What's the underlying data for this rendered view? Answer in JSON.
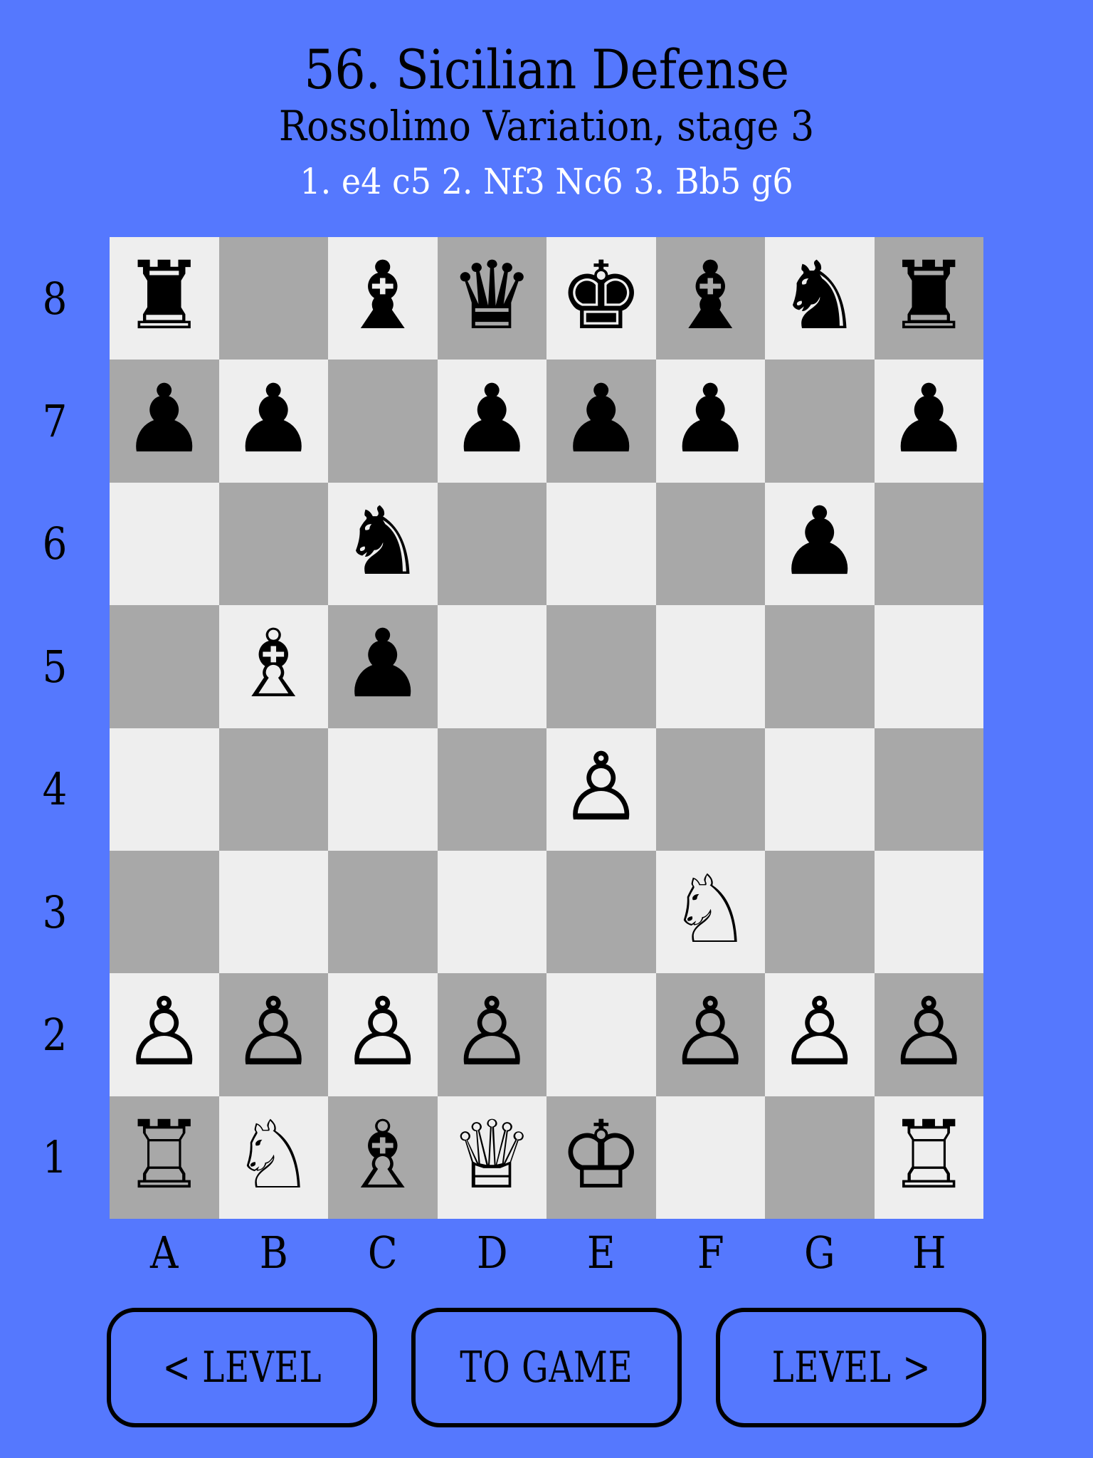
{
  "app": {
    "background_color": "#5578fe",
    "text_color": "#000000",
    "move_text_color": "#ffffff"
  },
  "header": {
    "title": "56. Sicilian Defense",
    "subtitle": "Rossolimo Variation, stage 3",
    "moves": "1. e4 c5 2. Nf3 Nc6 3. Bb5 g6"
  },
  "board": {
    "light_square_color": "#eeeeee",
    "dark_square_color": "#a8a8a8",
    "orientation": "white",
    "rank_labels": [
      "8",
      "7",
      "6",
      "5",
      "4",
      "3",
      "2",
      "1"
    ],
    "file_labels": [
      "A",
      "B",
      "C",
      "D",
      "E",
      "F",
      "G",
      "H"
    ],
    "fen": "r1bqkbnr/pp1ppp1p/2n3p1/1Bp5/4P3/5N2/PPPP1PPP/RNBQK2R",
    "squares": [
      [
        {
          "square": "a8",
          "shade": "light",
          "piece": "black-rook",
          "glyph": "♜"
        },
        {
          "square": "b8",
          "shade": "dark",
          "piece": null,
          "glyph": ""
        },
        {
          "square": "c8",
          "shade": "light",
          "piece": "black-bishop",
          "glyph": "♝"
        },
        {
          "square": "d8",
          "shade": "dark",
          "piece": "black-queen",
          "glyph": "♛"
        },
        {
          "square": "e8",
          "shade": "light",
          "piece": "black-king",
          "glyph": "♚"
        },
        {
          "square": "f8",
          "shade": "dark",
          "piece": "black-bishop",
          "glyph": "♝"
        },
        {
          "square": "g8",
          "shade": "light",
          "piece": "black-knight",
          "glyph": "♞"
        },
        {
          "square": "h8",
          "shade": "dark",
          "piece": "black-rook",
          "glyph": "♜"
        }
      ],
      [
        {
          "square": "a7",
          "shade": "dark",
          "piece": "black-pawn",
          "glyph": "♟"
        },
        {
          "square": "b7",
          "shade": "light",
          "piece": "black-pawn",
          "glyph": "♟"
        },
        {
          "square": "c7",
          "shade": "dark",
          "piece": null,
          "glyph": ""
        },
        {
          "square": "d7",
          "shade": "light",
          "piece": "black-pawn",
          "glyph": "♟"
        },
        {
          "square": "e7",
          "shade": "dark",
          "piece": "black-pawn",
          "glyph": "♟"
        },
        {
          "square": "f7",
          "shade": "light",
          "piece": "black-pawn",
          "glyph": "♟"
        },
        {
          "square": "g7",
          "shade": "dark",
          "piece": null,
          "glyph": ""
        },
        {
          "square": "h7",
          "shade": "light",
          "piece": "black-pawn",
          "glyph": "♟"
        }
      ],
      [
        {
          "square": "a6",
          "shade": "light",
          "piece": null,
          "glyph": ""
        },
        {
          "square": "b6",
          "shade": "dark",
          "piece": null,
          "glyph": ""
        },
        {
          "square": "c6",
          "shade": "light",
          "piece": "black-knight",
          "glyph": "♞"
        },
        {
          "square": "d6",
          "shade": "dark",
          "piece": null,
          "glyph": ""
        },
        {
          "square": "e6",
          "shade": "light",
          "piece": null,
          "glyph": ""
        },
        {
          "square": "f6",
          "shade": "dark",
          "piece": null,
          "glyph": ""
        },
        {
          "square": "g6",
          "shade": "light",
          "piece": "black-pawn",
          "glyph": "♟"
        },
        {
          "square": "h6",
          "shade": "dark",
          "piece": null,
          "glyph": ""
        }
      ],
      [
        {
          "square": "a5",
          "shade": "dark",
          "piece": null,
          "glyph": ""
        },
        {
          "square": "b5",
          "shade": "light",
          "piece": "white-bishop",
          "glyph": "♗"
        },
        {
          "square": "c5",
          "shade": "dark",
          "piece": "black-pawn",
          "glyph": "♟"
        },
        {
          "square": "d5",
          "shade": "light",
          "piece": null,
          "glyph": ""
        },
        {
          "square": "e5",
          "shade": "dark",
          "piece": null,
          "glyph": ""
        },
        {
          "square": "f5",
          "shade": "light",
          "piece": null,
          "glyph": ""
        },
        {
          "square": "g5",
          "shade": "dark",
          "piece": null,
          "glyph": ""
        },
        {
          "square": "h5",
          "shade": "light",
          "piece": null,
          "glyph": ""
        }
      ],
      [
        {
          "square": "a4",
          "shade": "light",
          "piece": null,
          "glyph": ""
        },
        {
          "square": "b4",
          "shade": "dark",
          "piece": null,
          "glyph": ""
        },
        {
          "square": "c4",
          "shade": "light",
          "piece": null,
          "glyph": ""
        },
        {
          "square": "d4",
          "shade": "dark",
          "piece": null,
          "glyph": ""
        },
        {
          "square": "e4",
          "shade": "light",
          "piece": "white-pawn",
          "glyph": "♙"
        },
        {
          "square": "f4",
          "shade": "dark",
          "piece": null,
          "glyph": ""
        },
        {
          "square": "g4",
          "shade": "light",
          "piece": null,
          "glyph": ""
        },
        {
          "square": "h4",
          "shade": "dark",
          "piece": null,
          "glyph": ""
        }
      ],
      [
        {
          "square": "a3",
          "shade": "dark",
          "piece": null,
          "glyph": ""
        },
        {
          "square": "b3",
          "shade": "light",
          "piece": null,
          "glyph": ""
        },
        {
          "square": "c3",
          "shade": "dark",
          "piece": null,
          "glyph": ""
        },
        {
          "square": "d3",
          "shade": "light",
          "piece": null,
          "glyph": ""
        },
        {
          "square": "e3",
          "shade": "dark",
          "piece": null,
          "glyph": ""
        },
        {
          "square": "f3",
          "shade": "light",
          "piece": "white-knight",
          "glyph": "♘"
        },
        {
          "square": "g3",
          "shade": "dark",
          "piece": null,
          "glyph": ""
        },
        {
          "square": "h3",
          "shade": "light",
          "piece": null,
          "glyph": ""
        }
      ],
      [
        {
          "square": "a2",
          "shade": "light",
          "piece": "white-pawn",
          "glyph": "♙"
        },
        {
          "square": "b2",
          "shade": "dark",
          "piece": "white-pawn",
          "glyph": "♙"
        },
        {
          "square": "c2",
          "shade": "light",
          "piece": "white-pawn",
          "glyph": "♙"
        },
        {
          "square": "d2",
          "shade": "dark",
          "piece": "white-pawn",
          "glyph": "♙"
        },
        {
          "square": "e2",
          "shade": "light",
          "piece": null,
          "glyph": ""
        },
        {
          "square": "f2",
          "shade": "dark",
          "piece": "white-pawn",
          "glyph": "♙"
        },
        {
          "square": "g2",
          "shade": "light",
          "piece": "white-pawn",
          "glyph": "♙"
        },
        {
          "square": "h2",
          "shade": "dark",
          "piece": "white-pawn",
          "glyph": "♙"
        }
      ],
      [
        {
          "square": "a1",
          "shade": "dark",
          "piece": "white-rook",
          "glyph": "♖"
        },
        {
          "square": "b1",
          "shade": "light",
          "piece": "white-knight",
          "glyph": "♘"
        },
        {
          "square": "c1",
          "shade": "dark",
          "piece": "white-bishop",
          "glyph": "♗"
        },
        {
          "square": "d1",
          "shade": "light",
          "piece": "white-queen",
          "glyph": "♕"
        },
        {
          "square": "e1",
          "shade": "dark",
          "piece": "white-king",
          "glyph": "♔"
        },
        {
          "square": "f1",
          "shade": "light",
          "piece": null,
          "glyph": ""
        },
        {
          "square": "g1",
          "shade": "dark",
          "piece": null,
          "glyph": ""
        },
        {
          "square": "h1",
          "shade": "light",
          "piece": "white-rook",
          "glyph": "♖"
        }
      ]
    ]
  },
  "buttons": [
    {
      "id": "prev-level",
      "label": "< LEVEL"
    },
    {
      "id": "to-game",
      "label": "TO GAME"
    },
    {
      "id": "next-level",
      "label": "LEVEL >"
    }
  ]
}
